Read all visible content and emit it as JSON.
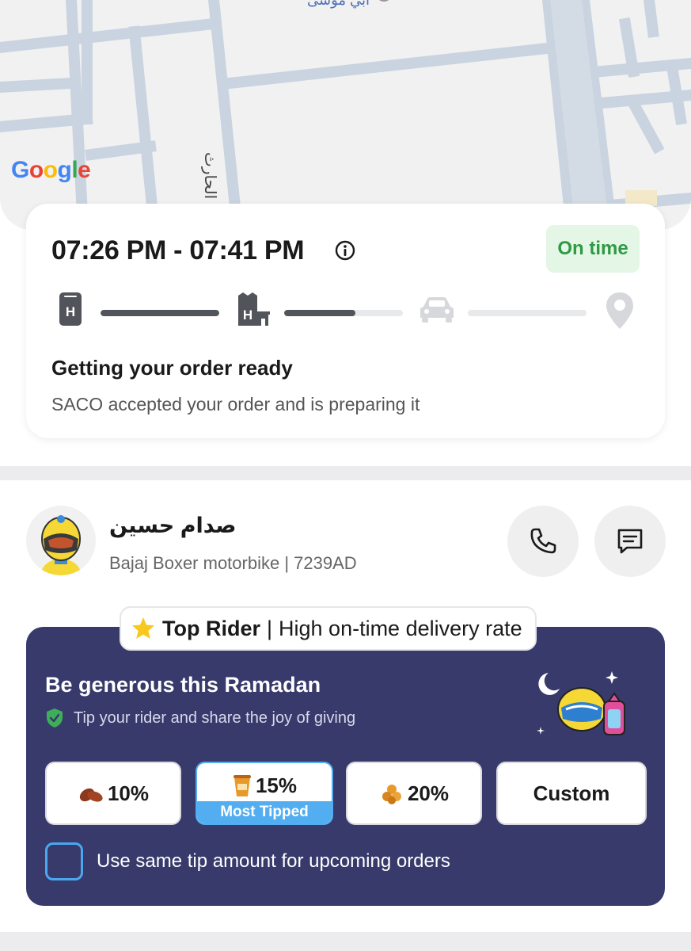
{
  "map": {
    "attribution": "Google",
    "street_label_1": "الحارث",
    "street_label_2": "أبي موسى"
  },
  "order": {
    "time_range": "07:26 PM - 07:41 PM",
    "status_badge": "On time",
    "status_title": "Getting your order ready",
    "status_description": "SACO accepted your order and is preparing it",
    "progress": {
      "steps": [
        "order-placed",
        "store-preparing",
        "on-the-way",
        "delivered"
      ],
      "segments": [
        1.0,
        0.6,
        0.0
      ]
    }
  },
  "rider": {
    "name": "صدام حسين",
    "vehicle": "Bajaj Boxer motorbike | 7239AD"
  },
  "badge": {
    "highlight": "Top Rider",
    "separator": "|",
    "text": "High on-time delivery rate"
  },
  "tip": {
    "title": "Be generous this Ramadan",
    "subtitle": "Tip your rider and share the joy of giving",
    "options": [
      {
        "label": "10%",
        "icon": "dates-icon"
      },
      {
        "label": "15%",
        "icon": "drink-cup-icon",
        "tag": "Most Tipped"
      },
      {
        "label": "20%",
        "icon": "sweets-icon"
      },
      {
        "label": "Custom"
      }
    ],
    "checkbox_label": "Use same tip amount for upcoming orders"
  },
  "colors": {
    "tip_card_bg": "#373a6b",
    "on_time_green": "#2f9a44",
    "most_tipped_blue": "#52aef0"
  }
}
